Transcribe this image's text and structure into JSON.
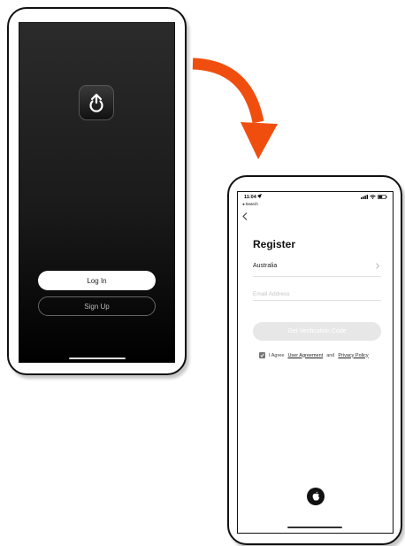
{
  "welcome_screen": {
    "login_label": "Log In",
    "signup_label": "Sign Up"
  },
  "register_screen": {
    "status": {
      "time": "11:04",
      "back_app": "◂ Search"
    },
    "title": "Register",
    "country": "Australia",
    "email_placeholder": "Email Address",
    "get_code_label": "Get Verification Code",
    "agree": {
      "prefix": "I Agree",
      "user_agreement": "User Agreement",
      "and": "and",
      "privacy_policy": "Privacy Policy"
    }
  },
  "colors": {
    "arrow": "#f04e0f",
    "dark_screen": "#1a1a1a",
    "disabled_button": "#e7e7e7"
  },
  "icons": [
    "power-icon",
    "chevron-left-icon",
    "chevron-right-icon",
    "apple-icon",
    "check-icon",
    "signal-icon",
    "wifi-icon",
    "battery-icon",
    "location-arrow-icon"
  ]
}
